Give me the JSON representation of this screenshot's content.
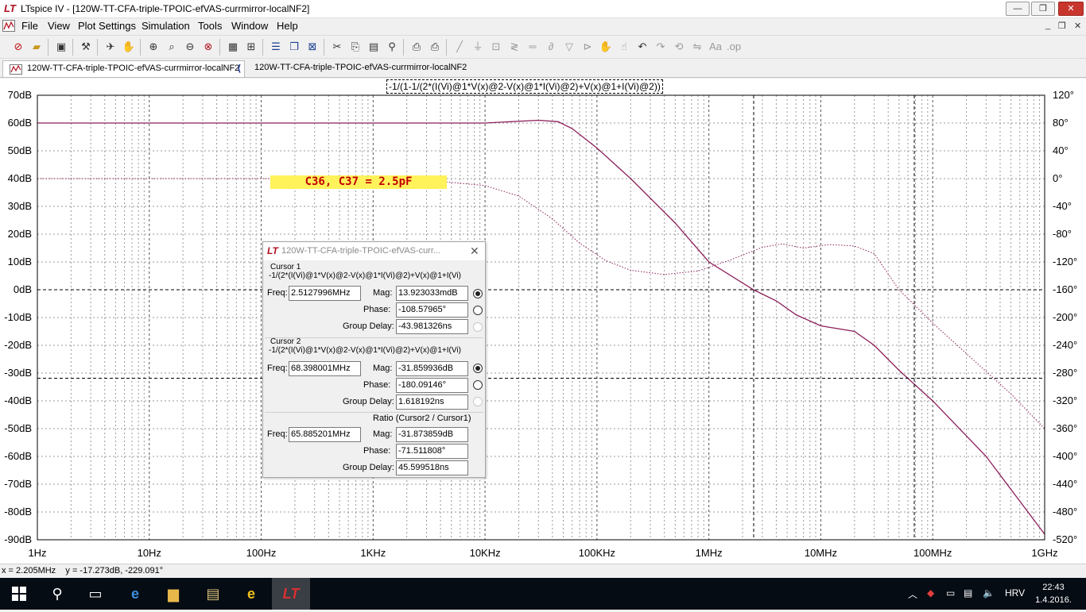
{
  "window": {
    "title": "LTspice IV - [120W-TT-CFA-triple-TPOIC-efVAS-currmirror-localNF2]",
    "controls": {
      "minimize": "—",
      "restore": "❐",
      "close": "✕"
    }
  },
  "menu": {
    "items": [
      "File",
      "View",
      "Plot Settings",
      "Simulation",
      "Tools",
      "Window",
      "Help"
    ],
    "mdi": {
      "minimize": "_",
      "restore": "❐",
      "close": "✕"
    }
  },
  "tabs": [
    {
      "label": "120W-TT-CFA-triple-TPOIC-efVAS-currmirror-localNF2",
      "icon": "waveform-icon"
    },
    {
      "label": "120W-TT-CFA-triple-TPOIC-efVAS-currmirror-localNF2",
      "icon": "schematic-icon"
    }
  ],
  "plot": {
    "trace_expression": "-1/(1-1/(2*(I(Vi)@1*V(x)@2-V(x)@1*I(Vi)@2)+V(x)@1+I(Vi)@2))",
    "annotation": "C36, C37 = 2.5pF",
    "trace_color": "#8c1f5a"
  },
  "chart_data": {
    "type": "line",
    "x_scale": "log",
    "xlim": [
      1,
      1000000000
    ],
    "x_tick_labels": [
      "1Hz",
      "10Hz",
      "100Hz",
      "1KHz",
      "10KHz",
      "100KHz",
      "1MHz",
      "10MHz",
      "100MHz",
      "1GHz"
    ],
    "y_left_ticks": [
      "70dB",
      "60dB",
      "50dB",
      "40dB",
      "30dB",
      "20dB",
      "10dB",
      "0dB",
      "-10dB",
      "-20dB",
      "-30dB",
      "-40dB",
      "-50dB",
      "-60dB",
      "-70dB",
      "-80dB",
      "-90dB"
    ],
    "y_right_ticks": [
      "120°",
      "80°",
      "40°",
      "0°",
      "-40°",
      "-80°",
      "-120°",
      "-160°",
      "-200°",
      "-240°",
      "-280°",
      "-320°",
      "-360°",
      "-400°",
      "-440°",
      "-480°",
      "-520°"
    ],
    "ylim_left": [
      -90,
      70
    ],
    "ylim_right": [
      -520,
      120
    ],
    "grid": true,
    "series": [
      {
        "style": "solid",
        "axis": "left",
        "x": [
          1,
          10,
          100,
          1000,
          10000,
          30000,
          45000,
          60000,
          100000,
          200000,
          500000,
          1000000,
          2500000,
          4000000,
          6000000,
          10000000,
          20000000,
          30000000,
          50000000,
          100000000,
          300000000,
          1000000000
        ],
        "y": [
          60,
          60,
          60,
          60,
          60,
          61,
          60.5,
          58,
          51,
          40,
          24,
          10,
          0,
          -4,
          -9,
          -13,
          -15,
          -20,
          -29,
          -40,
          -60,
          -88
        ]
      },
      {
        "style": "dotted",
        "axis": "right",
        "x": [
          1,
          100,
          1000,
          3000,
          10000,
          20000,
          40000,
          70000,
          120000,
          200000,
          400000,
          800000,
          1500000,
          3000000,
          4500000,
          7000000,
          12000000,
          20000000,
          30000000,
          50000000,
          100000000,
          200000000,
          500000000,
          1000000000
        ],
        "y": [
          0,
          0,
          0,
          -2,
          -10,
          -25,
          -58,
          -93,
          -118,
          -132,
          -138,
          -133,
          -118,
          -99,
          -94,
          -100,
          -95,
          -97,
          -108,
          -160,
          -208,
          -252,
          -310,
          -360
        ]
      }
    ],
    "cursors": [
      {
        "name": "cursor-1",
        "x": 2512799.6
      },
      {
        "name": "cursor-2",
        "x": 68398001
      }
    ]
  },
  "cursor_dialog": {
    "title": "120W-TT-CFA-triple-TPOIC-efVAS-curr...",
    "cursor1": {
      "heading": "Cursor 1",
      "expression": "-1/(2*(I(Vi)@1*V(x)@2-V(x)@1*I(Vi)@2)+V(x)@1+I(Vi)",
      "freq_label": "Freq:",
      "freq": "2.5127996MHz",
      "mag_label": "Mag:",
      "mag": "13.923033mdB",
      "phase_label": "Phase:",
      "phase": "-108.57965°",
      "gd_label": "Group Delay:",
      "gd": "-43.981326ns"
    },
    "cursor2": {
      "heading": "Cursor 2",
      "expression": "-1/(2*(I(Vi)@1*V(x)@2-V(x)@1*I(Vi)@2)+V(x)@1+I(Vi)",
      "freq_label": "Freq:",
      "freq": "68.398001MHz",
      "mag_label": "Mag:",
      "mag": "-31.859936dB",
      "phase_label": "Phase:",
      "phase": "-180.09146°",
      "gd_label": "Group Delay:",
      "gd": "1.618192ns"
    },
    "ratio": {
      "heading": "Ratio (Cursor2 / Cursor1)",
      "freq_label": "Freq:",
      "freq": "65.885201MHz",
      "mag_label": "Mag:",
      "mag": "-31.873859dB",
      "phase_label": "Phase:",
      "phase": "-71.511808°",
      "gd_label": "Group Delay:",
      "gd": "45.599518ns"
    }
  },
  "status": {
    "text": "x = 2.205MHz    y = -17.273dB, -229.091°"
  },
  "taskbar": {
    "language": "HRV",
    "time": "22:43",
    "date": "1.4.2016."
  }
}
